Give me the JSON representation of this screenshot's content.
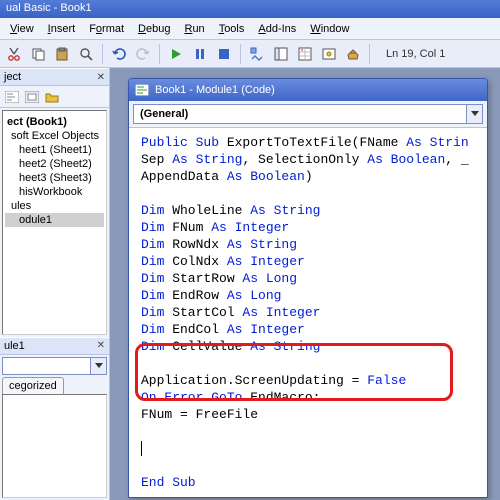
{
  "app_title": "ual Basic - Book1",
  "menus": {
    "view": "View",
    "insert": "Insert",
    "format": "Format",
    "debug": "Debug",
    "run": "Run",
    "tools": "Tools",
    "addins": "Add-Ins",
    "window": "Window"
  },
  "status": {
    "position": "Ln 19, Col 1"
  },
  "project_panel": {
    "title": "ject",
    "root": "ect (Book1)",
    "group1": "soft Excel Objects",
    "sheet1": "heet1 (Sheet1)",
    "sheet2": "heet2 (Sheet2)",
    "sheet3": "heet3 (Sheet3)",
    "wb": "hisWorkbook",
    "group2": "ules",
    "mod": "odule1"
  },
  "props_panel": {
    "title": "ule1",
    "combo": "",
    "tab1": "cegorized"
  },
  "code_window": {
    "title": "Book1 - Module1 (Code)",
    "dd_left": "(General)"
  },
  "code": {
    "l1a": "Public Sub",
    "l1b": " ExportToTextFile(FName ",
    "l1c": "As Strin",
    "l2a": "Sep ",
    "l2b": "As String",
    "l2c": ", SelectionOnly ",
    "l2d": "As Boolean",
    "l2e": ", _",
    "l3a": "AppendData ",
    "l3b": "As Boolean",
    "l3c": ")",
    "l5a": "Dim",
    "l5b": " WholeLine ",
    "l5c": "As String",
    "l6a": "Dim",
    "l6b": " FNum ",
    "l6c": "As Integer",
    "l7a": "Dim",
    "l7b": " RowNdx ",
    "l7c": "As String",
    "l8a": "Dim",
    "l8b": " ColNdx ",
    "l8c": "As Integer",
    "l9a": "Dim",
    "l9b": " StartRow ",
    "l9c": "As Long",
    "l10a": "Dim",
    "l10b": " EndRow ",
    "l10c": "As Long",
    "l11a": "Dim",
    "l11b": " StartCol ",
    "l11c": "As Integer",
    "l12a": "Dim",
    "l12b": " EndCol ",
    "l12c": "As Integer",
    "l13a": "Dim",
    "l13b": " CellValue ",
    "l13c": "As String",
    "l15": "Application.ScreenUpdating = ",
    "l15b": "False",
    "l16a": "On Error GoTo",
    "l16b": " EndMacro:",
    "l17": "FNum = FreeFile",
    "l21": "End Sub"
  }
}
